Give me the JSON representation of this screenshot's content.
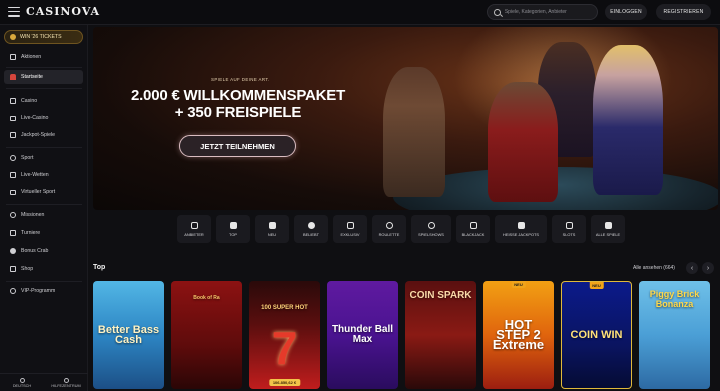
{
  "header": {
    "logo": "CASINOVA",
    "search_placeholder": "Spiele, Kategorien, Anbieter",
    "login_label": "EINLOGGEN",
    "register_label": "REGISTRIEREN"
  },
  "sidebar": {
    "promo_label": "WIN '26 TICKETS",
    "items": [
      {
        "label": "Aktionen",
        "icon": "gift-icon"
      },
      {
        "label": "Startseite",
        "icon": "home-icon"
      },
      {
        "label": "Casino",
        "icon": "casino-icon"
      },
      {
        "label": "Live-Casino",
        "icon": "live-casino-icon"
      },
      {
        "label": "Jackpot-Spiele",
        "icon": "jackpot-icon"
      },
      {
        "label": "Sport",
        "icon": "sport-icon"
      },
      {
        "label": "Live-Wetten",
        "icon": "live-bet-icon"
      },
      {
        "label": "Virtueller Sport",
        "icon": "virtual-sport-icon"
      },
      {
        "label": "Missionen",
        "icon": "missions-icon"
      },
      {
        "label": "Turniere",
        "icon": "trophy-icon"
      },
      {
        "label": "Bonus Crab",
        "icon": "crab-icon"
      },
      {
        "label": "Shop",
        "icon": "shop-icon"
      },
      {
        "label": "VIP-Programm",
        "icon": "vip-icon"
      }
    ],
    "footer": {
      "language_label": "DEUTSCH",
      "help_label": "HILFEZENTRUM"
    }
  },
  "hero": {
    "subtitle": "SPIELE AUF DEINE ART.",
    "title_line1": "2.000 € WILLKOMMENSPAKET",
    "title_line2": "+ 350 FREISPIELE",
    "cta_label": "JETZT TEILNEHMEN"
  },
  "categories": [
    {
      "label": "ANBIETER"
    },
    {
      "label": "TOP"
    },
    {
      "label": "NEU"
    },
    {
      "label": "BELIEBT"
    },
    {
      "label": "EXKLUSIV"
    },
    {
      "label": "ROULETTE"
    },
    {
      "label": "SPIELSHOWS"
    },
    {
      "label": "BLACKJACK"
    },
    {
      "label": "HEISSE JACKPOTS"
    },
    {
      "label": "SLOTS"
    },
    {
      "label": "ALLE SPIELE"
    }
  ],
  "top_section": {
    "title": "Top",
    "see_all": "Alle ansehen (664)",
    "tiles": [
      {
        "title": "Better Bass Cash"
      },
      {
        "title": "Book of Ra"
      },
      {
        "title": "100 SUPER HOT",
        "price": "106.850,62 €"
      },
      {
        "title": "Thunder Ball Max"
      },
      {
        "title": "COIN SPARK"
      },
      {
        "title": "HOT STEP 2 Extreme",
        "badge": "NEU"
      },
      {
        "title": "COIN WIN",
        "badge": "NEU"
      },
      {
        "title": "Piggy Brick Bonanza"
      }
    ]
  }
}
